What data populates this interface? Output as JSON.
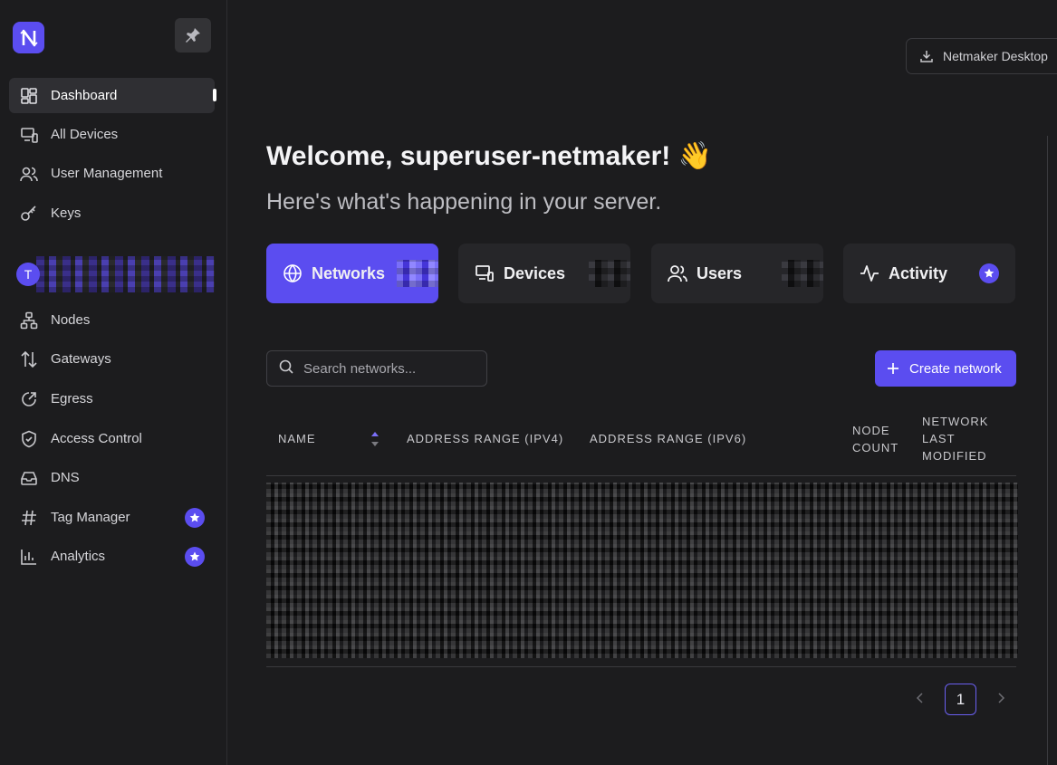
{
  "sidebar": {
    "items": [
      {
        "label": "Dashboard"
      },
      {
        "label": "All Devices"
      },
      {
        "label": "User Management"
      },
      {
        "label": "Keys"
      },
      {
        "label": "Nodes"
      },
      {
        "label": "Gateways"
      },
      {
        "label": "Egress"
      },
      {
        "label": "Access Control"
      },
      {
        "label": "DNS"
      },
      {
        "label": "Tag Manager"
      },
      {
        "label": "Analytics"
      }
    ],
    "tenant_initial": "T"
  },
  "header": {
    "desktop_button": "Netmaker Desktop"
  },
  "welcome": {
    "title": "Welcome, superuser-netmaker! 👋",
    "subtitle": "Here's what's happening in your server."
  },
  "tabs": [
    {
      "label": "Networks"
    },
    {
      "label": "Devices"
    },
    {
      "label": "Users"
    },
    {
      "label": "Activity"
    }
  ],
  "search": {
    "placeholder": "Search networks..."
  },
  "create_button": "Create network",
  "table": {
    "columns": [
      "NAME",
      "ADDRESS RANGE (IPV4)",
      "ADDRESS RANGE (IPV6)",
      "NODE COUNT",
      "NETWORK LAST MODIFIED"
    ]
  },
  "pagination": {
    "current_page": "1"
  },
  "colors": {
    "accent": "#5b4df0",
    "background": "#1c1c1e",
    "card": "#262629"
  }
}
